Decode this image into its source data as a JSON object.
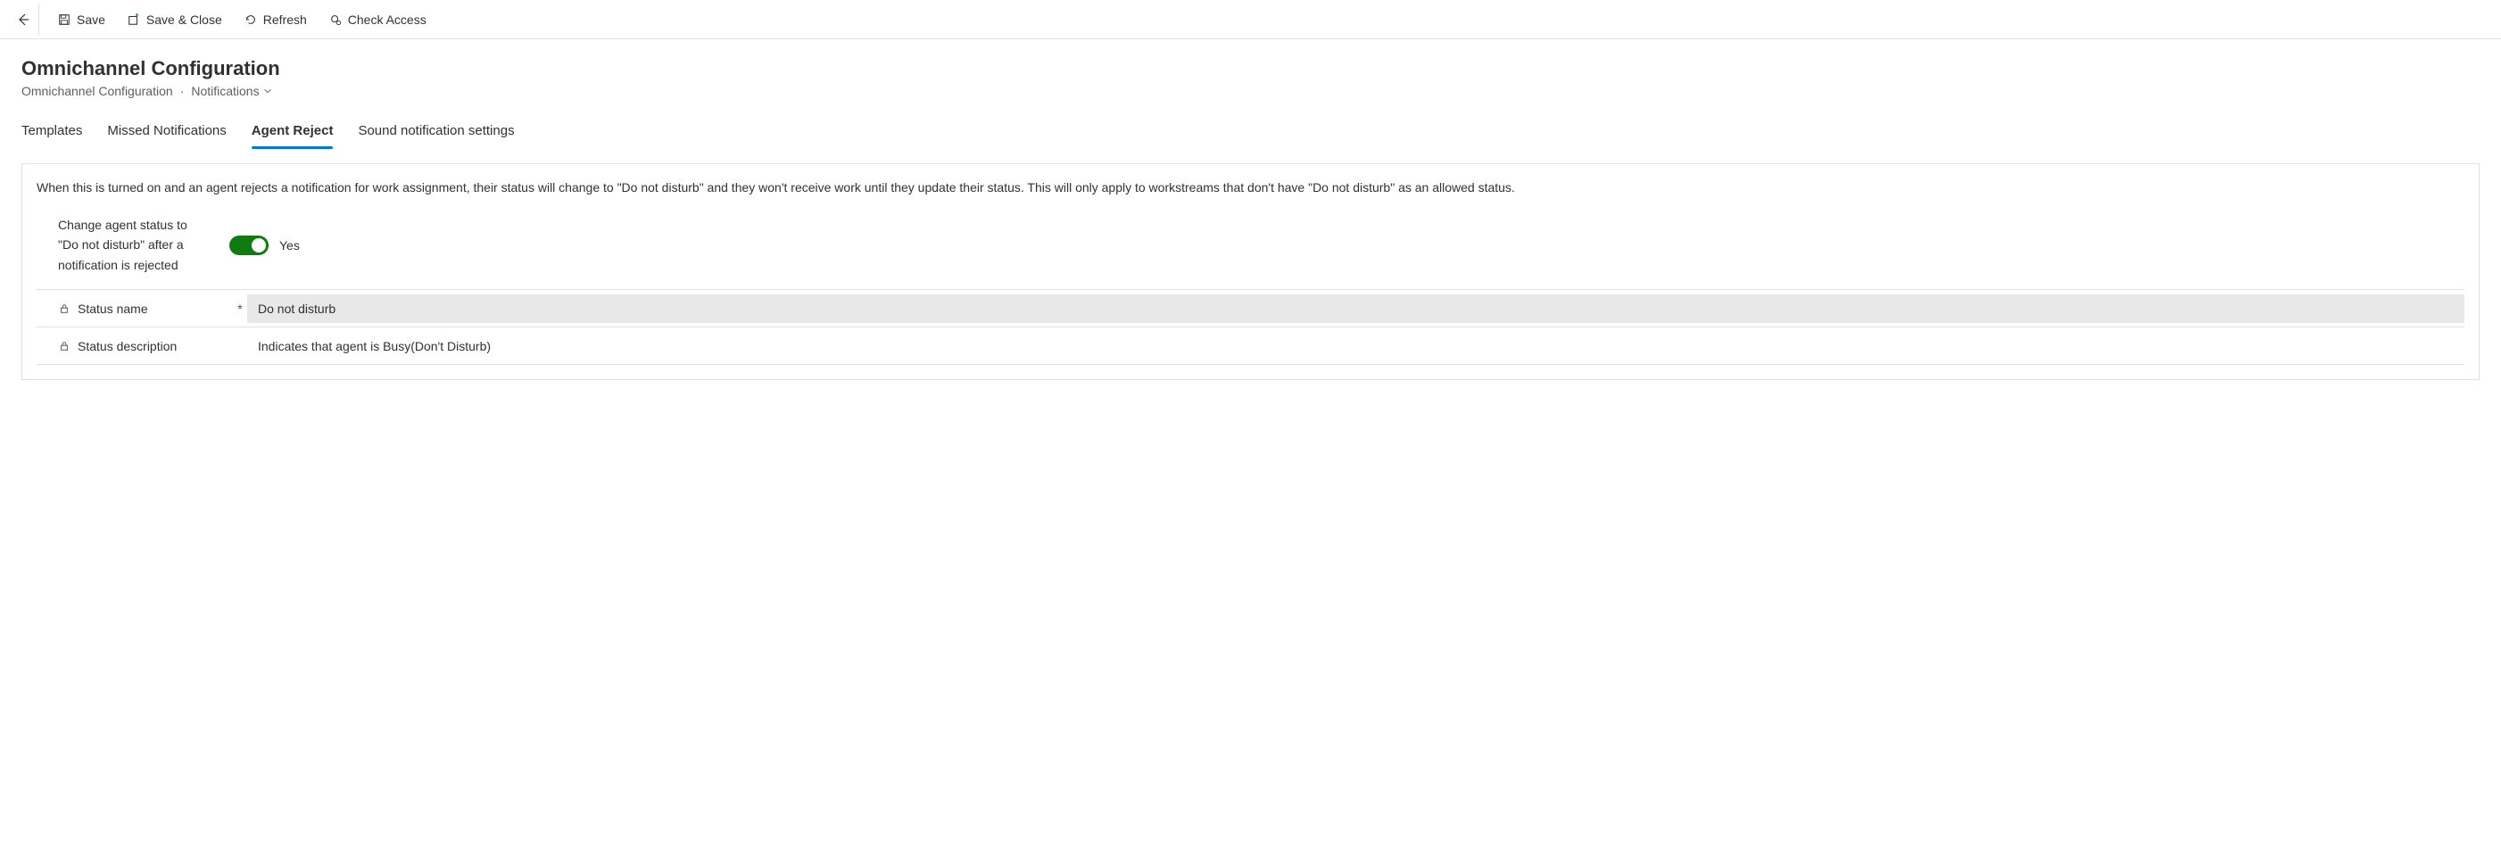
{
  "toolbar": {
    "save": "Save",
    "saveClose": "Save & Close",
    "refresh": "Refresh",
    "checkAccess": "Check Access"
  },
  "header": {
    "title": "Omnichannel Configuration",
    "breadcrumb": {
      "entity": "Omnichannel Configuration",
      "view": "Notifications"
    }
  },
  "tabs": [
    {
      "label": "Templates",
      "active": false
    },
    {
      "label": "Missed Notifications",
      "active": false
    },
    {
      "label": "Agent Reject",
      "active": true
    },
    {
      "label": "Sound notification settings",
      "active": false
    }
  ],
  "panel": {
    "description": "When this is turned on and an agent rejects a notification for work assignment, their status will change to \"Do not disturb\" and they won't receive work until they update their status. This will only apply to workstreams that don't have \"Do not disturb\" as an allowed status.",
    "toggle": {
      "label": "Change agent status to \"Do not disturb\" after a notification is rejected",
      "valueText": "Yes",
      "on": true
    },
    "fields": {
      "statusName": {
        "label": "Status name",
        "required": true,
        "locked": true,
        "value": "Do not disturb"
      },
      "statusDescription": {
        "label": "Status description",
        "required": false,
        "locked": true,
        "value": "Indicates that agent is Busy(Don't Disturb)"
      }
    }
  }
}
